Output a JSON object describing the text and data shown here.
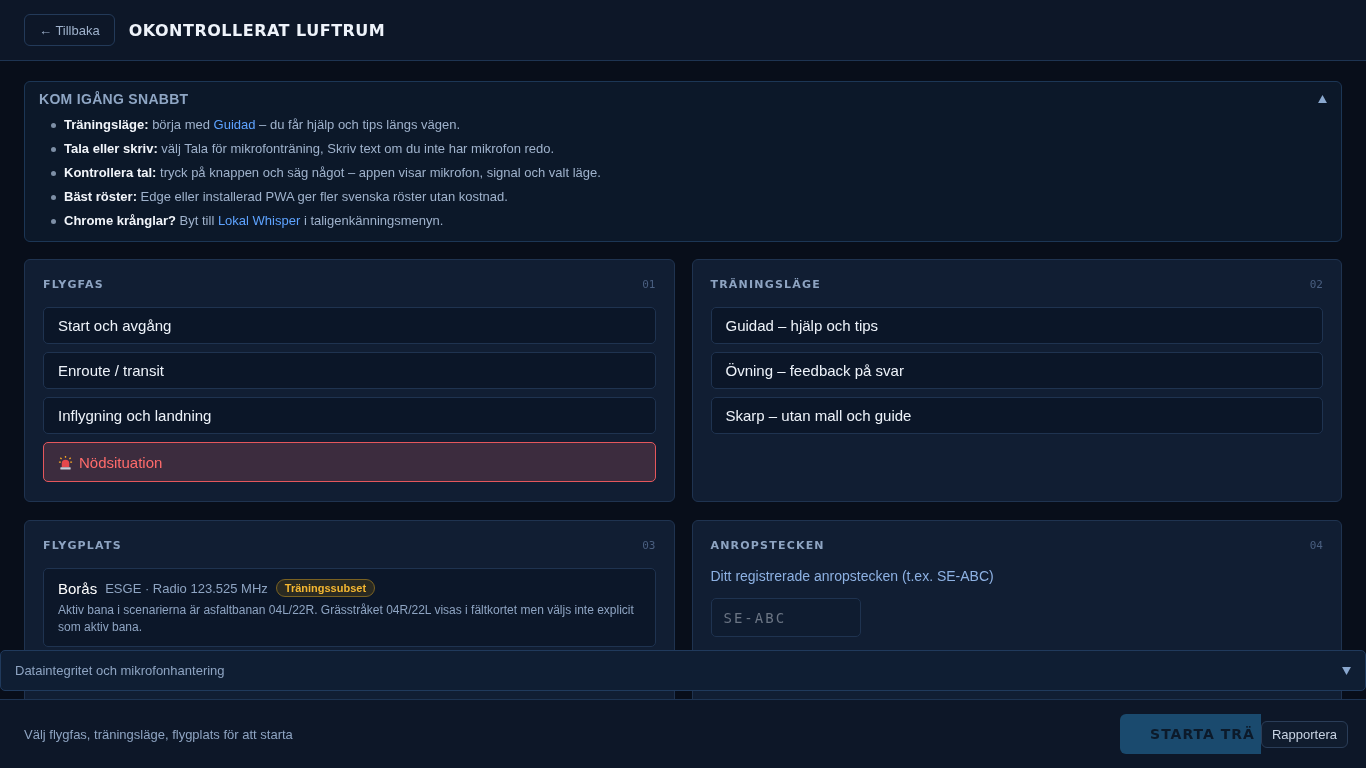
{
  "header": {
    "back": "← Tillbaka",
    "title": "OKONTROLLERAT LUFTRUM"
  },
  "quickstart": {
    "title": "KOM IGÅNG SNABBT",
    "expanded": true,
    "tips": [
      {
        "label": "Träningsläge:",
        "parts": [
          {
            "kind": "text",
            "text": " börja med "
          },
          {
            "kind": "link",
            "text": "Guidad"
          },
          {
            "kind": "text",
            "text": " – du får hjälp och tips längs vägen."
          }
        ]
      },
      {
        "label": "Tala eller skriv:",
        "parts": [
          {
            "kind": "text",
            "text": " välj Tala för mikrofonträning, Skriv text om du inte har mikrofon redo."
          }
        ]
      },
      {
        "label": "Kontrollera tal:",
        "parts": [
          {
            "kind": "text",
            "text": " tryck på knappen och säg något – appen visar mikrofon, signal och valt läge."
          }
        ]
      },
      {
        "label": "Bäst röster:",
        "parts": [
          {
            "kind": "text",
            "text": " Edge eller installerad PWA ger fler svenska röster utan kostnad."
          }
        ]
      },
      {
        "label": "Chrome krånglar?",
        "parts": [
          {
            "kind": "text",
            "text": " Byt till "
          },
          {
            "kind": "link",
            "text": "Lokal Whisper"
          },
          {
            "kind": "text",
            "text": " i taligenkänningsmenyn."
          }
        ]
      }
    ]
  },
  "sections": [
    {
      "kind": "options",
      "title": "FLYGFAS",
      "number": "01",
      "options": [
        {
          "label": "Start och avgång",
          "kind": "normal",
          "selected": false
        },
        {
          "label": "Enroute / transit",
          "kind": "normal",
          "selected": false
        },
        {
          "label": "Inflygning och landning",
          "kind": "normal",
          "selected": false
        },
        {
          "label": "Nödsituation",
          "kind": "emergency",
          "selected": false
        }
      ]
    },
    {
      "kind": "options",
      "title": "TRÄNINGSLÄGE",
      "number": "02",
      "options": [
        {
          "label": "Guidad – hjälp och tips",
          "kind": "normal",
          "selected": false
        },
        {
          "label": "Övning – feedback på svar",
          "kind": "normal",
          "selected": false
        },
        {
          "label": "Skarp – utan mall och guide",
          "kind": "normal",
          "selected": false
        }
      ]
    },
    {
      "kind": "airport",
      "title": "FLYGPLATS",
      "number": "03",
      "airport": {
        "name": "Borås",
        "meta": "ESGE · Radio 123.525 MHz",
        "badge": "Träningssubset",
        "description": "Aktiv bana i scenarierna är asfaltbanan 04L/22R. Grässtråket 04R/22L visas i fältkortet men väljs inte explicit som aktiv bana."
      }
    },
    {
      "kind": "callsign",
      "title": "ANROPSTECKEN",
      "number": "04",
      "label": "Ditt registrerade anropstecken (t.ex. SE-ABC)",
      "placeholder": "SE-ABC"
    }
  ],
  "data_section": {
    "title": "Dataintegritet och mikrofonhantering",
    "expanded": false
  },
  "footer": {
    "hint": "Välj flygfas, träningsläge, flygplats för att starta",
    "start": "STARTA TRÄ",
    "report": "Rapportera"
  }
}
